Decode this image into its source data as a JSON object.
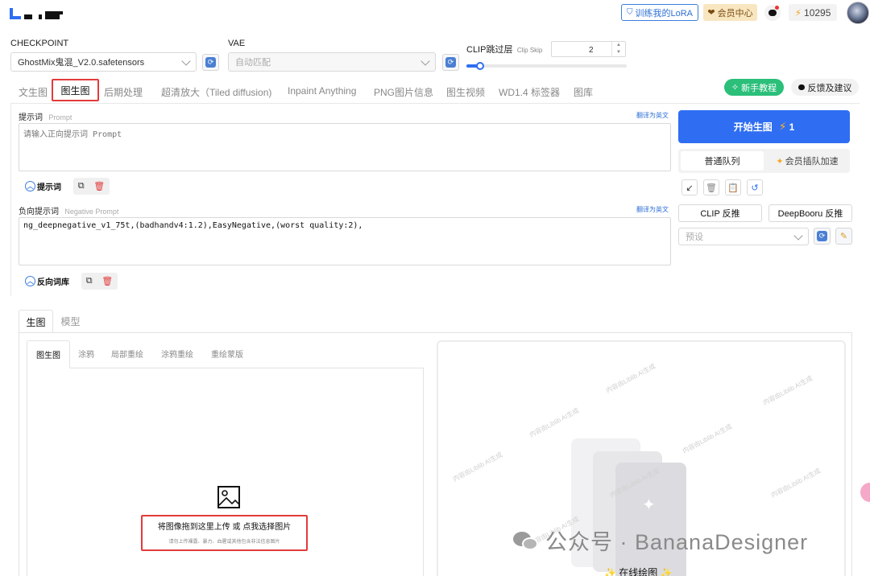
{
  "header": {
    "lora_button": "训练我的LoRA",
    "vip_button": "会员中心",
    "credits": "10295"
  },
  "checkpoint": {
    "label": "CHECKPOINT",
    "value": "GhostMix鬼混_V2.0.safetensors"
  },
  "vae": {
    "label": "VAE",
    "value": "自动匹配"
  },
  "clip": {
    "label": "CLIP跳过层",
    "sublabel": "Clip Skip",
    "value": "2",
    "slider_fraction": 0.08
  },
  "tabs": {
    "items": [
      "文生图",
      "后期处理",
      "超清放大（Tiled diffusion)",
      "Inpaint Anything",
      "PNG图片信息",
      "图生视频",
      "WD1.4 标签器",
      "图库"
    ],
    "active": "图生图"
  },
  "help": {
    "tutorial": "新手教程",
    "feedback": "反馈及建议"
  },
  "prompt": {
    "label": "提示词",
    "sublabel": "Prompt",
    "translate": "翻译为英文",
    "placeholder": "请输入正向提示词 Prompt",
    "toggle": "提示词"
  },
  "negative": {
    "label": "负向提示词",
    "sublabel": "Negative Prompt",
    "translate": "翻译为英文",
    "value": "ng_deepnegative_v1_75t,(badhandv4:1.2),EasyNegative,(worst quality:2),",
    "toggle": "反向词库"
  },
  "generate": {
    "label": "开始生图",
    "cost": "1"
  },
  "queue": {
    "normal": "普通队列",
    "vip": "会员插队加速"
  },
  "interrogate": {
    "clip": "CLIP 反推",
    "deepbooru": "DeepBooru 反推"
  },
  "preset": {
    "placeholder": "预设"
  },
  "section_tabs": [
    "生图",
    "模型"
  ],
  "img_tabs": [
    "图生图",
    "涂鸦",
    "局部重绘",
    "涂鸦重绘",
    "重绘蒙版"
  ],
  "upload": {
    "title": "将图像拖到这里上传 或 点我选择图片",
    "note": "请勿上传裸露、暴力、血腥或其他包含非法信息图片"
  },
  "watermark": {
    "text": "内容由Liblib AI生成",
    "wechat": "公众号 · BananaDesigner"
  },
  "online": "在线绘图"
}
